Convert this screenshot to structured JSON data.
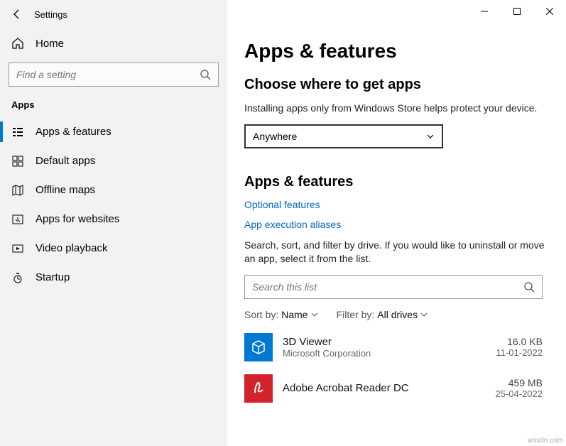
{
  "window": {
    "title": "Settings"
  },
  "sidebar": {
    "home": "Home",
    "search_placeholder": "Find a setting",
    "section": "Apps",
    "items": [
      {
        "label": "Apps & features"
      },
      {
        "label": "Default apps"
      },
      {
        "label": "Offline maps"
      },
      {
        "label": "Apps for websites"
      },
      {
        "label": "Video playback"
      },
      {
        "label": "Startup"
      }
    ]
  },
  "main": {
    "title": "Apps & features",
    "section1_title": "Choose where to get apps",
    "section1_body": "Installing apps only from Windows Store helps protect your device.",
    "dropdown_value": "Anywhere",
    "section2_title": "Apps & features",
    "link_optional": "Optional features",
    "link_aliases": "App execution aliases",
    "list_body": "Search, sort, and filter by drive. If you would like to uninstall or move an app, select it from the list.",
    "list_search_placeholder": "Search this list",
    "sort_label": "Sort by:",
    "sort_value": "Name",
    "filter_label": "Filter by:",
    "filter_value": "All drives",
    "apps": [
      {
        "name": "3D Viewer",
        "publisher": "Microsoft Corporation",
        "size": "16.0 KB",
        "date": "11-01-2022"
      },
      {
        "name": "Adobe Acrobat Reader DC",
        "publisher": "",
        "size": "459 MB",
        "date": "25-04-2022"
      }
    ]
  },
  "watermark": "wsxdn.com"
}
